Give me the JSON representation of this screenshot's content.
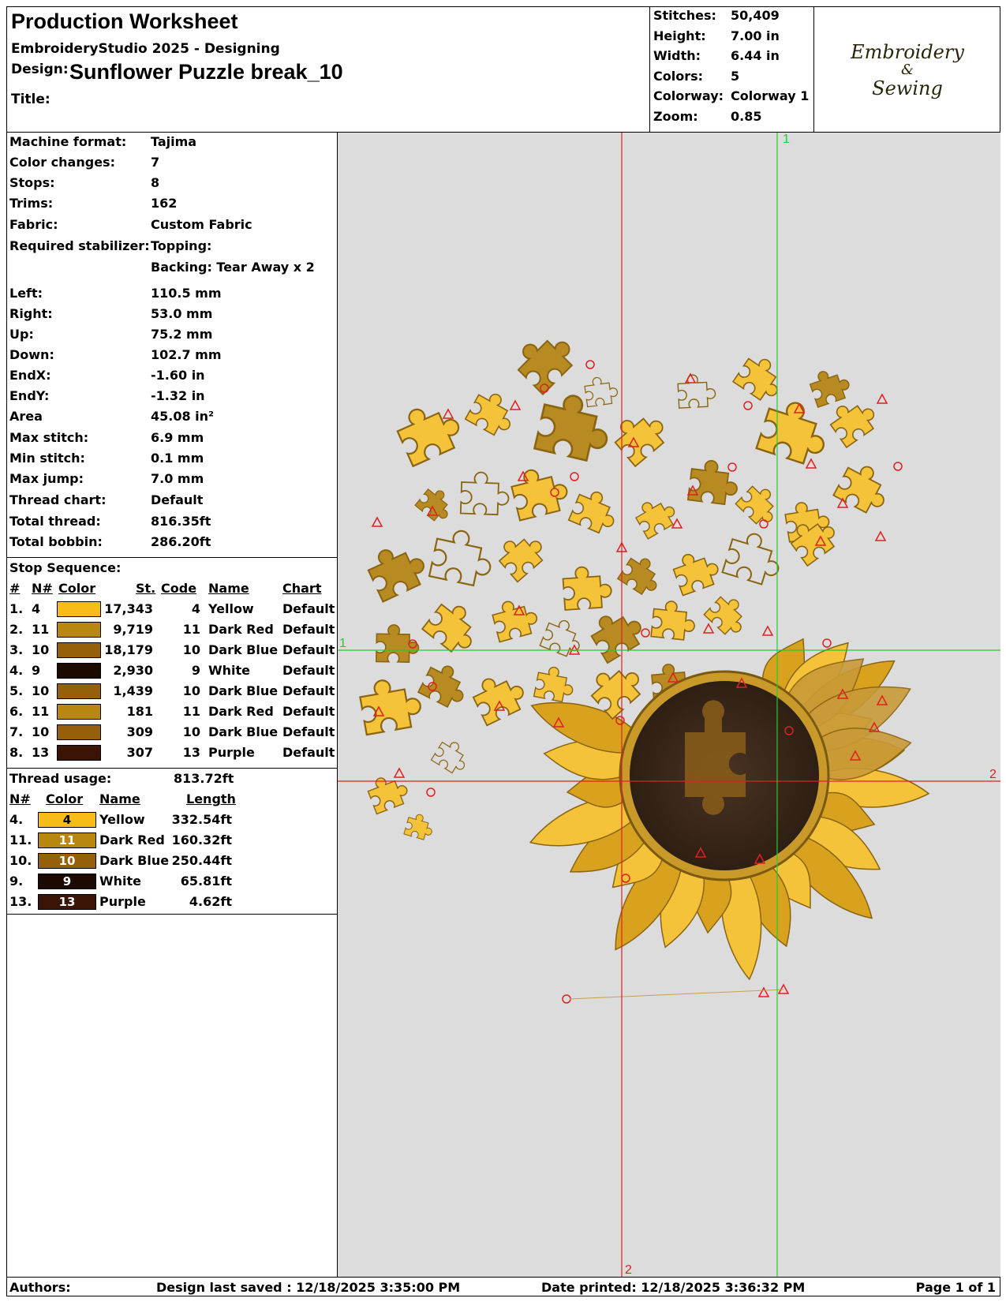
{
  "header": {
    "title": "Production Worksheet",
    "software": "EmbroideryStudio 2025 - Designing",
    "design_label": "Design:",
    "design_name": "Sunflower Puzzle break_10",
    "title_label": "Title:"
  },
  "stats": [
    {
      "label": "Stitches:",
      "value": "50,409"
    },
    {
      "label": "Height:",
      "value": "7.00 in"
    },
    {
      "label": "Width:",
      "value": "6.44 in"
    },
    {
      "label": "Colors:",
      "value": "5"
    },
    {
      "label": "Colorway:",
      "value": "Colorway 1"
    },
    {
      "label": "Zoom:",
      "value": "0.85"
    }
  ],
  "logo": {
    "line1": "Embroidery",
    "line2": "&",
    "line3": "Sewing"
  },
  "info": [
    {
      "label": "Machine format:",
      "value": "Tajima"
    },
    {
      "label": "Color changes:",
      "value": "7"
    },
    {
      "label": "Stops:",
      "value": "8"
    },
    {
      "label": "Trims:",
      "value": "162"
    },
    {
      "label": "Fabric:",
      "value": "Custom Fabric"
    },
    {
      "label": "Required stabilizer:",
      "value": "Topping:"
    },
    {
      "label": "",
      "value": "Backing: Tear Away x 2"
    }
  ],
  "extents": [
    {
      "label": "Left:",
      "value": "110.5 mm"
    },
    {
      "label": "Right:",
      "value": "53.0 mm"
    },
    {
      "label": "Up:",
      "value": "75.2 mm"
    },
    {
      "label": "Down:",
      "value": "102.7 mm"
    },
    {
      "label": "EndX:",
      "value": "-1.60 in"
    },
    {
      "label": "EndY:",
      "value": "-1.32 in"
    },
    {
      "label": "Area",
      "value": " 45.08 in²"
    },
    {
      "label": "Max stitch:",
      "value": "6.9 mm"
    },
    {
      "label": "Min stitch:",
      "value": "0.1 mm"
    },
    {
      "label": "Max jump:",
      "value": "7.0 mm"
    },
    {
      "label": "Thread chart:",
      "value": "Default"
    },
    {
      "label": "Total thread:",
      "value": "816.35ft"
    },
    {
      "label": "Total bobbin:",
      "value": "286.20ft"
    }
  ],
  "stop_sequence": {
    "label": "Stop Sequence:",
    "headers": {
      "num": "#",
      "n": "N#",
      "color": "Color",
      "st": "St.",
      "code": "Code",
      "name": "Name",
      "chart": "Chart"
    },
    "rows": [
      {
        "num": "1.",
        "n": "4",
        "color": "#f7bc18",
        "st": "17,343",
        "code": "4",
        "name": "Yellow",
        "chart": "Default"
      },
      {
        "num": "2.",
        "n": "11",
        "color": "#b8870f",
        "st": "9,719",
        "code": "11",
        "name": "Dark Red",
        "chart": "Default"
      },
      {
        "num": "3.",
        "n": "10",
        "color": "#96600a",
        "st": "18,179",
        "code": "10",
        "name": "Dark Blue",
        "chart": "Default"
      },
      {
        "num": "4.",
        "n": "9",
        "color": "#1b0a02",
        "st": "2,930",
        "code": "9",
        "name": "White",
        "chart": "Default"
      },
      {
        "num": "5.",
        "n": "10",
        "color": "#96600a",
        "st": "1,439",
        "code": "10",
        "name": "Dark Blue",
        "chart": "Default"
      },
      {
        "num": "6.",
        "n": "11",
        "color": "#b8870f",
        "st": "181",
        "code": "11",
        "name": "Dark Red",
        "chart": "Default"
      },
      {
        "num": "7.",
        "n": "10",
        "color": "#96600a",
        "st": "309",
        "code": "10",
        "name": "Dark Blue",
        "chart": "Default"
      },
      {
        "num": "8.",
        "n": "13",
        "color": "#3a1405",
        "st": "307",
        "code": "13",
        "name": "Purple",
        "chart": "Default"
      }
    ]
  },
  "thread_usage": {
    "label": "Thread usage:",
    "total": "813.72ft",
    "headers": {
      "n": "N#",
      "color": "Color",
      "name": "Name",
      "length": "Length"
    },
    "rows": [
      {
        "n": "4.",
        "code": "4",
        "color": "#f7bc18",
        "text_color": "#000000",
        "name": "Yellow",
        "length": "332.54ft"
      },
      {
        "n": "11.",
        "code": "11",
        "color": "#b8870f",
        "text_color": "#ffffff",
        "name": "Dark Red",
        "length": "160.32ft"
      },
      {
        "n": "10.",
        "code": "10",
        "color": "#96600a",
        "text_color": "#ffffff",
        "name": "Dark Blue",
        "length": "250.44ft"
      },
      {
        "n": "9.",
        "code": "9",
        "color": "#1b0a02",
        "text_color": "#ffffff",
        "name": "White",
        "length": "65.81ft"
      },
      {
        "n": "13.",
        "code": "13",
        "color": "#3a1405",
        "text_color": "#ffffff",
        "name": "Purple",
        "length": "4.62ft"
      }
    ]
  },
  "canvas": {
    "axis_labels": {
      "v1": "1",
      "h1": "1",
      "h2": "2",
      "v2": "2"
    },
    "colors": {
      "background": "#dcdcdc",
      "petal": "#f5c33a",
      "petal_dark": "#d9a21e",
      "outline": "#8a6410",
      "center": "#3e2a1c",
      "red_axis": "#e02020",
      "green_axis": "#22cc33"
    }
  },
  "footer": {
    "authors": "Authors:",
    "saved": "Design last saved : 12/18/2025 3:35:00 PM",
    "printed": "Date printed: 12/18/2025 3:36:32 PM",
    "page": "Page 1 of 1"
  }
}
